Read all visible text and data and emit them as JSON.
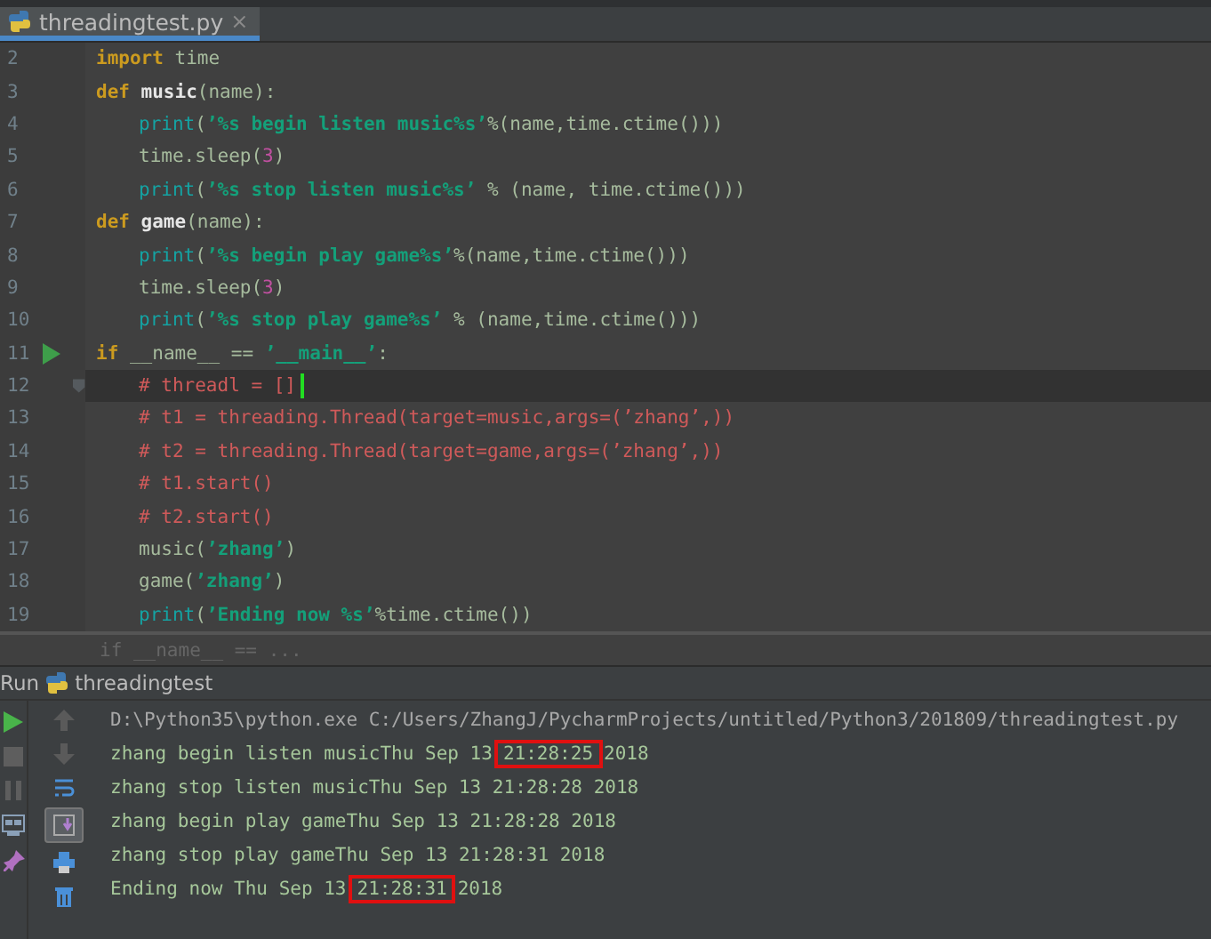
{
  "tab": {
    "title": "threadingtest.py",
    "close": "×",
    "selected": true
  },
  "code_lines": [
    {
      "number": "2",
      "indented": false,
      "segments": [
        {
          "kind": "kw",
          "text": "import"
        },
        {
          "kind": "plain",
          "text": " time"
        }
      ]
    },
    {
      "number": "3",
      "indented": false,
      "segments": [
        {
          "kind": "kw",
          "text": "def"
        },
        {
          "kind": "def",
          "text": "music"
        },
        {
          "kind": "plain",
          "text": "(name):"
        }
      ]
    },
    {
      "number": "4",
      "indented": true,
      "segments": [
        {
          "kind": "fn",
          "text": "print"
        },
        {
          "kind": "plain",
          "text": "("
        },
        {
          "kind": "str",
          "text": "’%s begin listen music%s’"
        },
        {
          "kind": "plain",
          "text": "%(name,time.ctime()))"
        }
      ]
    },
    {
      "number": "5",
      "indented": true,
      "segments": [
        {
          "kind": "plain",
          "text": "time.sleep("
        },
        {
          "kind": "num",
          "text": "3"
        },
        {
          "kind": "plain",
          "text": ")"
        }
      ]
    },
    {
      "number": "6",
      "indented": true,
      "segments": [
        {
          "kind": "fn",
          "text": "print"
        },
        {
          "kind": "plain",
          "text": "("
        },
        {
          "kind": "str",
          "text": "’%s stop listen music%s’"
        },
        {
          "kind": "plain",
          "text": " % (name, time.ctime()))"
        }
      ]
    },
    {
      "number": "7",
      "indented": false,
      "segments": [
        {
          "kind": "kw",
          "text": "def"
        },
        {
          "kind": "def",
          "text": "game"
        },
        {
          "kind": "plain",
          "text": "(name):"
        }
      ]
    },
    {
      "number": "8",
      "indented": true,
      "segments": [
        {
          "kind": "fn",
          "text": "print"
        },
        {
          "kind": "plain",
          "text": "("
        },
        {
          "kind": "str",
          "text": "’%s begin play game%s’"
        },
        {
          "kind": "plain",
          "text": "%(name,time.ctime()))"
        }
      ]
    },
    {
      "number": "9",
      "indented": true,
      "segments": [
        {
          "kind": "plain",
          "text": "time.sleep("
        },
        {
          "kind": "num",
          "text": "3"
        },
        {
          "kind": "plain",
          "text": ")"
        }
      ]
    },
    {
      "number": "10",
      "indented": true,
      "segments": [
        {
          "kind": "fn",
          "text": "print"
        },
        {
          "kind": "plain",
          "text": "("
        },
        {
          "kind": "str",
          "text": "’%s stop play game%s’"
        },
        {
          "kind": "plain",
          "text": " % (name,time.ctime()))"
        }
      ]
    },
    {
      "number": "11",
      "indented": false,
      "run_marker": true,
      "segments": [
        {
          "kind": "kw",
          "text": "if"
        },
        {
          "kind": "plain",
          "text": " __name__ == "
        },
        {
          "kind": "str",
          "text": "’__main__’"
        },
        {
          "kind": "plain",
          "text": ":"
        }
      ]
    },
    {
      "number": "12",
      "indented": true,
      "current": true,
      "fold_marker": true,
      "segments": [
        {
          "kind": "comment",
          "text": "# threadl = []"
        }
      ]
    },
    {
      "number": "13",
      "indented": true,
      "segments": [
        {
          "kind": "comment",
          "text": "# t1 = threading.Thread(target=music,args=(’zhang’,))"
        }
      ]
    },
    {
      "number": "14",
      "indented": true,
      "segments": [
        {
          "kind": "comment",
          "text": "# t2 = threading.Thread(target=game,args=(’zhang’,))"
        }
      ]
    },
    {
      "number": "15",
      "indented": true,
      "segments": [
        {
          "kind": "comment",
          "text": "# t1.start()"
        }
      ]
    },
    {
      "number": "16",
      "indented": true,
      "segments": [
        {
          "kind": "comment",
          "text": "# t2.start()"
        }
      ]
    },
    {
      "number": "17",
      "indented": true,
      "segments": [
        {
          "kind": "plain",
          "text": "music("
        },
        {
          "kind": "str",
          "text": "’zhang’"
        },
        {
          "kind": "plain",
          "text": ")"
        }
      ]
    },
    {
      "number": "18",
      "indented": true,
      "segments": [
        {
          "kind": "plain",
          "text": "game("
        },
        {
          "kind": "str",
          "text": "’zhang’"
        },
        {
          "kind": "plain",
          "text": ")"
        }
      ]
    },
    {
      "number": "19",
      "indented": true,
      "segments": [
        {
          "kind": "fn",
          "text": "print"
        },
        {
          "kind": "plain",
          "text": "("
        },
        {
          "kind": "str",
          "text": "’Ending now %s’"
        },
        {
          "kind": "plain",
          "text": "%time.ctime())"
        }
      ]
    }
  ],
  "breadcrumb": "if __name__ == ...",
  "run_panel": {
    "label": "Run",
    "config": "threadingtest",
    "console": [
      {
        "kind": "command",
        "segments": [
          {
            "text": "D:\\Python35\\python.exe C:/Users/ZhangJ/PycharmProjects/untitled/Python3/201809/threadingtest.py",
            "boxed": false
          }
        ]
      },
      {
        "kind": "output",
        "segments": [
          {
            "text": "zhang begin listen musicThu Sep 13",
            "boxed": false
          },
          {
            "text": "21:28:25",
            "boxed": true
          },
          {
            "text": "2018",
            "boxed": false
          }
        ]
      },
      {
        "kind": "output",
        "segments": [
          {
            "text": "zhang stop listen musicThu Sep 13 21:28:28 2018",
            "boxed": false
          }
        ]
      },
      {
        "kind": "output",
        "segments": [
          {
            "text": "zhang begin play gameThu Sep 13 21:28:28 2018",
            "boxed": false
          }
        ]
      },
      {
        "kind": "output",
        "segments": [
          {
            "text": "zhang stop play gameThu Sep 13 21:28:31 2018",
            "boxed": false
          }
        ]
      },
      {
        "kind": "output",
        "segments": [
          {
            "text": "Ending now Thu Sep 13",
            "boxed": false
          },
          {
            "text": "21:28:31",
            "boxed": true
          },
          {
            "text": "2018",
            "boxed": false
          }
        ]
      }
    ],
    "scroll_to_end_on": true
  }
}
